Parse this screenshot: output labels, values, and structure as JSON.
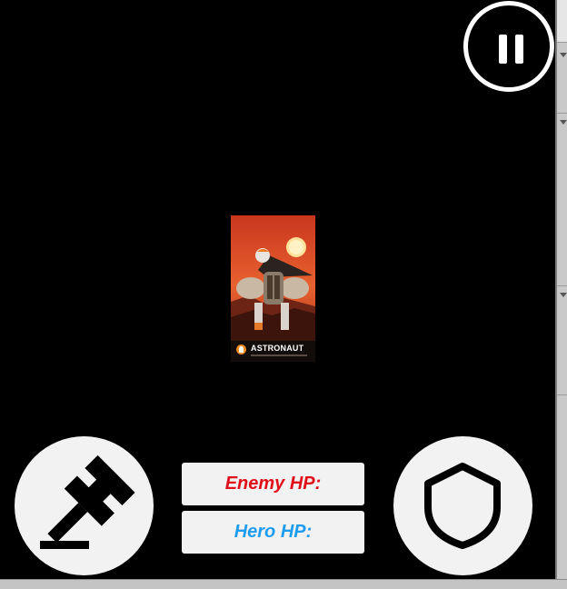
{
  "controls": {
    "pause_icon": "pause-icon",
    "attack_icon": "gavel-icon",
    "defend_icon": "shield-icon"
  },
  "character_card": {
    "name": "ASTRONAUT"
  },
  "hud": {
    "enemy_hp_label": "Enemy HP:",
    "hero_hp_label": "Hero HP:"
  },
  "colors": {
    "background": "#000000",
    "button_fill": "#f2f2f2",
    "enemy_hp_text": "#e0101a",
    "hero_hp_text": "#1e9cf0",
    "card_sky": "#e0522a"
  }
}
